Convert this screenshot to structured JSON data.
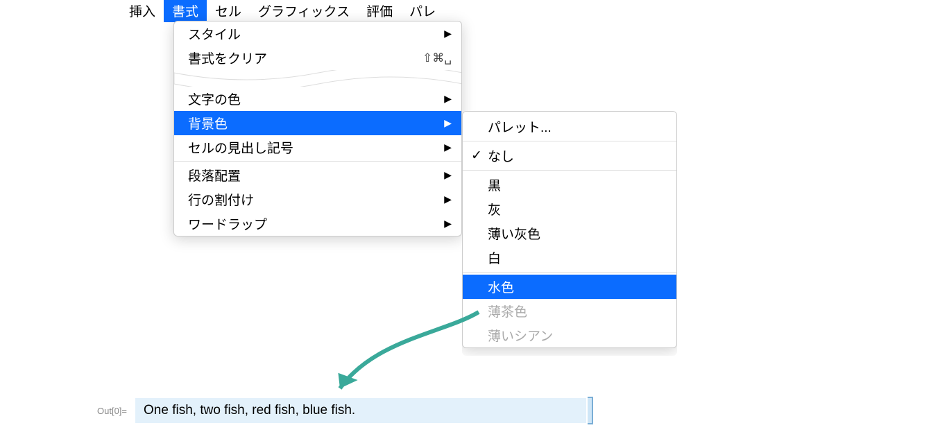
{
  "menubar": {
    "items": [
      {
        "label": "挿入"
      },
      {
        "label": "書式",
        "selected": true
      },
      {
        "label": "セル"
      },
      {
        "label": "グラフィックス"
      },
      {
        "label": "評価"
      },
      {
        "label": "パレ"
      }
    ]
  },
  "dropdown": {
    "section1": [
      {
        "label": "スタイル",
        "hasArrow": true
      },
      {
        "label": "書式をクリア",
        "shortcut": "⇧⌘␣"
      }
    ],
    "section2": [
      {
        "label": "文字の色",
        "hasArrow": true
      },
      {
        "label": "背景色",
        "hasArrow": true,
        "selected": true
      },
      {
        "label": "セルの見出し記号",
        "hasArrow": true
      }
    ],
    "section3": [
      {
        "label": "段落配置",
        "hasArrow": true
      },
      {
        "label": "行の割付け",
        "hasArrow": true
      },
      {
        "label": "ワードラップ",
        "hasArrow": true
      }
    ]
  },
  "submenu": {
    "palette": "パレット...",
    "none": "なし",
    "colors1": [
      {
        "label": "黒"
      },
      {
        "label": "灰"
      },
      {
        "label": "薄い灰色"
      },
      {
        "label": "白"
      }
    ],
    "colors2": [
      {
        "label": "水色",
        "selected": true
      },
      {
        "label": "薄茶色",
        "faded": true
      },
      {
        "label": "薄いシアン",
        "faded": true
      }
    ]
  },
  "output": {
    "label": "Out[0]=",
    "text": "One fish, two fish, red fish, blue fish."
  }
}
